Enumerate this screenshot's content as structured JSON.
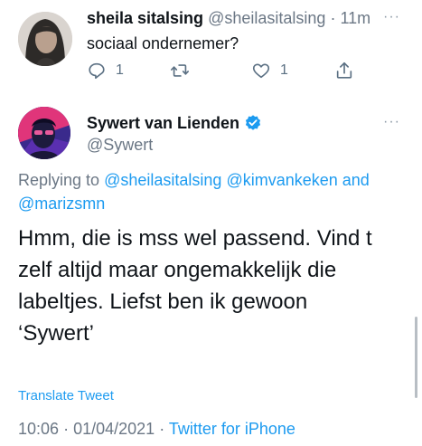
{
  "reply_tweet": {
    "display_name": "sheila sitalsing",
    "handle": "@sheilasitalsing",
    "separator": "·",
    "time": "11m",
    "more": "···",
    "text": "sociaal ondernemer?",
    "actions": {
      "reply_count": "1",
      "retweet_count": "",
      "like_count": "1"
    }
  },
  "main_tweet": {
    "display_name": "Sywert van Lienden",
    "verified": true,
    "handle": "@Sywert",
    "more": "···",
    "replying_prefix": "Replying to",
    "mentions": [
      "@sheilasitalsing",
      "@kimvankeken",
      "@marizsmn"
    ],
    "mention_joiner": "and",
    "body_lines": [
      "Hmm, die is mss wel passend. Vind t",
      "zelf altijd maar ongemakkelijk die",
      "labeltjes. Liefst ben ik gewoon",
      "‘Sywert’"
    ],
    "translate_label": "Translate Tweet",
    "time": "10:06",
    "date": "01/04/2021",
    "separator": "·",
    "source": "Twitter for iPhone"
  },
  "colors": {
    "link": "#1d9bf0",
    "secondary_text": "#6b7785",
    "primary_text": "#0f1419",
    "verified_badge": "#1d9bf0"
  },
  "icons": [
    "reply-icon",
    "retweet-icon",
    "like-icon",
    "share-icon",
    "verified-badge-icon",
    "more-icon"
  ]
}
